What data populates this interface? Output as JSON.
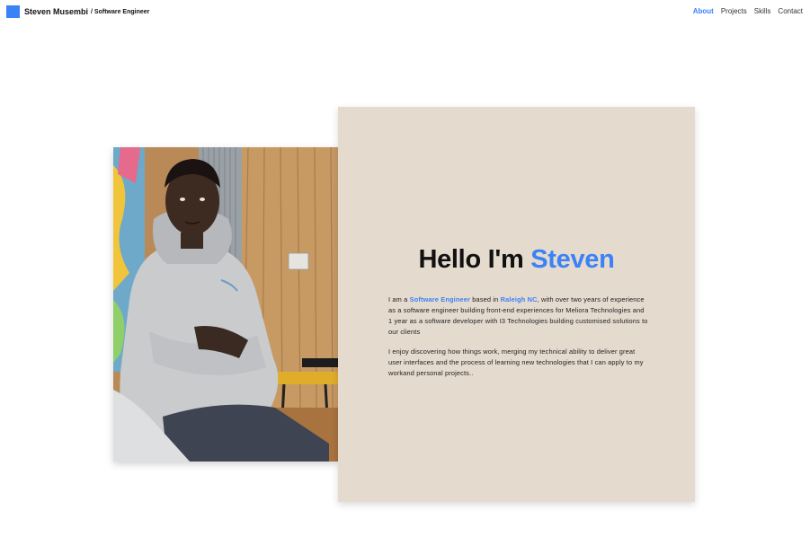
{
  "header": {
    "brand_name": "Steven Musembi",
    "brand_role": "/ Software Engineer",
    "nav": [
      {
        "label": "About",
        "active": true
      },
      {
        "label": "Projects",
        "active": false
      },
      {
        "label": "Skills",
        "active": false
      },
      {
        "label": "Contact",
        "active": false
      }
    ]
  },
  "hero": {
    "greeting": "Hello I'm ",
    "name": "Steven",
    "intro": {
      "prefix": "I am a ",
      "role": "Software Engineer",
      "mid": " based in ",
      "location": "Raleigh NC",
      "suffix": ", with over two years of experience as a software engineer building front-end experiences for Meliora Technologies and 1 year as a software developer with I3 Technologies building customised solutions to our clients"
    },
    "second_paragraph": "I enjoy discovering how things work, merging my technical ability to deliver great user interfaces and the process of learning new technologies that I can apply to my workand personal projects.."
  },
  "colors": {
    "accent": "#3b82f6",
    "card_background": "#e5dace"
  }
}
